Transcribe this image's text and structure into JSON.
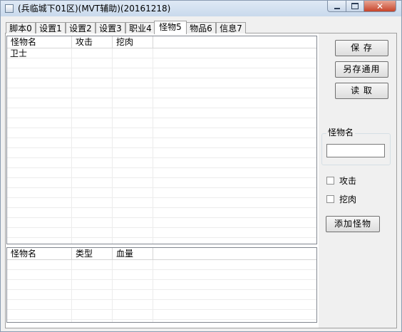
{
  "window": {
    "title": "(兵临城下01区)(MVT辅助)(20161218)",
    "close_glyph": "✕"
  },
  "tabs": [
    {
      "label": "脚本0"
    },
    {
      "label": "设置1"
    },
    {
      "label": "设置2"
    },
    {
      "label": "设置3"
    },
    {
      "label": "职业4"
    },
    {
      "label": "怪物5"
    },
    {
      "label": "物品6"
    },
    {
      "label": "信息7"
    }
  ],
  "active_tab": "怪物5",
  "monster_list": {
    "columns": [
      "怪物名",
      "攻击",
      "挖肉"
    ],
    "rows": [
      [
        "卫士",
        "",
        ""
      ]
    ]
  },
  "type_list": {
    "columns": [
      "怪物名",
      "类型",
      "血量"
    ],
    "rows": []
  },
  "buttons": {
    "save": "保 存",
    "save_as": "另存通用",
    "read": "读 取",
    "add_monster": "添加怪物"
  },
  "monster_name_group": {
    "label": "怪物名",
    "value": ""
  },
  "checkboxes": {
    "attack": {
      "label": "攻击",
      "checked": false
    },
    "dig": {
      "label": "挖肉",
      "checked": false
    }
  }
}
